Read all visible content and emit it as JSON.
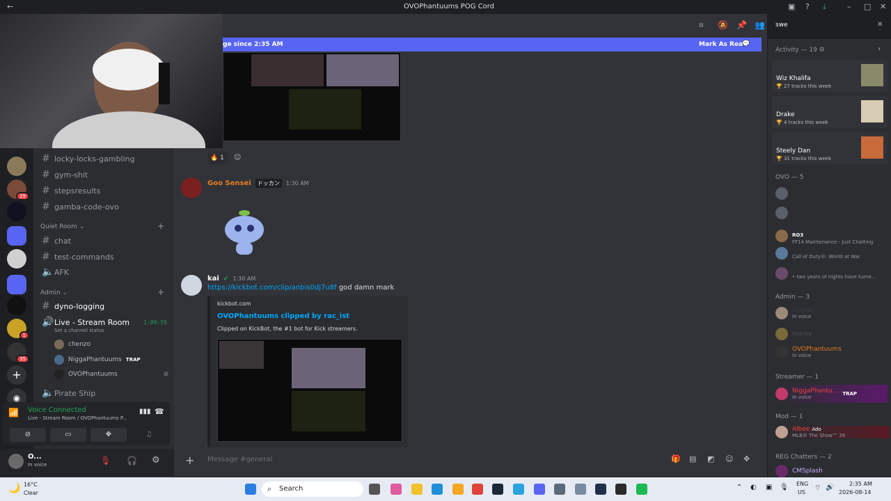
{
  "window": {
    "title": "OVOPhantuums POG Cord",
    "search_value": "swe"
  },
  "banner": {
    "text": "ge since 2:35 AM",
    "action": "Mark As Read"
  },
  "reactions": [
    {
      "emoji": "🔥",
      "count": "1"
    }
  ],
  "messages": [
    {
      "author": "Goo Sensei",
      "tag": "ドッカン",
      "time": "1:30 AM",
      "color": "#e67e22"
    },
    {
      "author": "kai",
      "time": "1:30 AM",
      "link": "https://kickbot.com/clip/anbis0dj7u8f",
      "text": "god damn mark",
      "embed": {
        "provider": "kickbot.com",
        "title": "OVOPhantuums clipped by rac_ist",
        "description": "Clipped on KickBot, the #1 bot for Kick streamers."
      }
    }
  ],
  "channels": {
    "top": [
      "locky-locks-gambling",
      "gym-shit",
      "stepsresults",
      "gamba-code-ovo"
    ],
    "quiet_room": {
      "label": "Quiet Room",
      "items": [
        "chat",
        "test-commands",
        "AFK"
      ]
    },
    "admin": {
      "label": "Admin",
      "items": [
        "dyno-logging"
      ]
    },
    "live": {
      "name": "Live - Stream Room",
      "timer": "1:09:55",
      "status": "Set a channel status",
      "users": [
        {
          "name": "chenzo"
        },
        {
          "name": "NiggaPhantuums",
          "tag": "TRAP"
        },
        {
          "name": "OVOPhantuums"
        }
      ]
    },
    "pirate": "Pirate Ship"
  },
  "voice": {
    "status": "Voice Connected",
    "location": "Live - Stream Room / OVOPhantuums P..."
  },
  "user": {
    "name": "O...",
    "status": "In voice"
  },
  "composer": {
    "placeholder": "Message #general"
  },
  "members": {
    "activity_header": "Activity — 19",
    "activity": [
      {
        "artist": "Wiz Khalifa",
        "tracks": "27 tracks this week"
      },
      {
        "artist": "Drake",
        "tracks": "4 tracks this week"
      },
      {
        "artist": "Steely Dan",
        "tracks": "31 tracks this week"
      }
    ],
    "ovo_header": "OVO — 5",
    "ovo": [
      {
        "sub": "FF14 Maintenance - Just Chatting",
        "tag": "RO3"
      },
      {
        "sub": "Call of Duty®: World at War"
      },
      {
        "sub": "• two years of nights have turne..."
      }
    ],
    "admin_header": "Admin — 3",
    "admin": [
      {
        "name": "chenzo",
        "sub": "In voice"
      },
      {
        "name": "marky",
        "sub": ""
      },
      {
        "name": "OVOPhantuums",
        "sub": "In voice"
      }
    ],
    "streamer_header": "Streamer — 1",
    "streamer": [
      {
        "name": "NiggaPhantu...",
        "sub": "In voice",
        "tag": "TRAP"
      }
    ],
    "mod_header": "Mod — 1",
    "mod": [
      {
        "name": "Albee",
        "sub": "MLB® The Show™ 26",
        "tag": "Ado"
      }
    ],
    "reg_header": "REG Chatters — 2",
    "reg": [
      {
        "name": "CMSplash"
      }
    ]
  },
  "taskbar": {
    "weather_temp": "16°C",
    "weather_desc": "Clear",
    "search": "Search",
    "lang": "ENG",
    "region": "US",
    "time": "2:35 AM",
    "date": "2026-08-14"
  }
}
